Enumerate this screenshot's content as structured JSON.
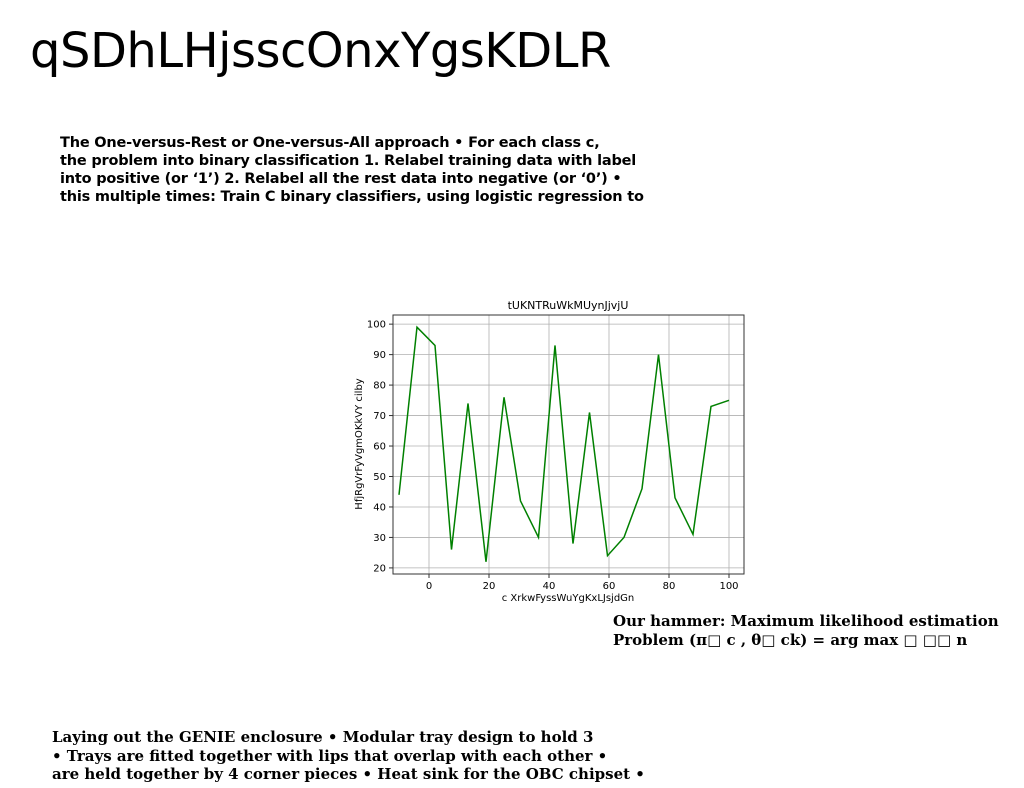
{
  "page": {
    "title": "qSDhLHjsscOnxYgsKDLR"
  },
  "blocks": {
    "ovr_lines": [
      "The One-versus-Rest or One-versus-All approach • For each class c,",
      "the problem into binary classification 1. Relabel training data with label",
      "into positive (or ‘1’) 2. Relabel all the rest data into negative (or ‘0’) •",
      "this multiple times: Train C binary classifiers, using logistic regression to"
    ],
    "mle_lines": [
      "Our hammer: Maximum likelihood estimation",
      "Problem (π□ c , θ□ ck) = arg max □ □□ n"
    ],
    "genie_lines": [
      "Laying out the GENIE enclosure • Modular tray design to hold 3",
      "• Trays are fitted together with lips that overlap with each other •",
      "are held together by 4 corner pieces • Heat sink for the OBC chipset •"
    ]
  },
  "chart_data": {
    "type": "line",
    "title": "tUKNTRuWkMUynJjvjU",
    "xlabel": "c XrkwFyssWuYgKxLJsjdGn",
    "ylabel": "HfjRgVrFyVgmOKkVY cilby",
    "xlim": [
      -12,
      105
    ],
    "ylim": [
      18,
      103
    ],
    "xticks": [
      0,
      20,
      40,
      60,
      80,
      100
    ],
    "yticks": [
      20,
      30,
      40,
      50,
      60,
      70,
      80,
      90,
      100
    ],
    "grid": true,
    "series": [
      {
        "color": "#008000",
        "x": [
          -10,
          -4,
          2,
          7.5,
          13,
          19,
          25,
          30.5,
          36.5,
          42,
          48,
          53.5,
          59.5,
          65,
          71,
          76.5,
          82,
          88,
          94,
          100
        ],
        "y": [
          44,
          99,
          93,
          26,
          74,
          22,
          76,
          42,
          30,
          93,
          28,
          71,
          24,
          30,
          46,
          90,
          43,
          31,
          73,
          75
        ]
      }
    ]
  }
}
